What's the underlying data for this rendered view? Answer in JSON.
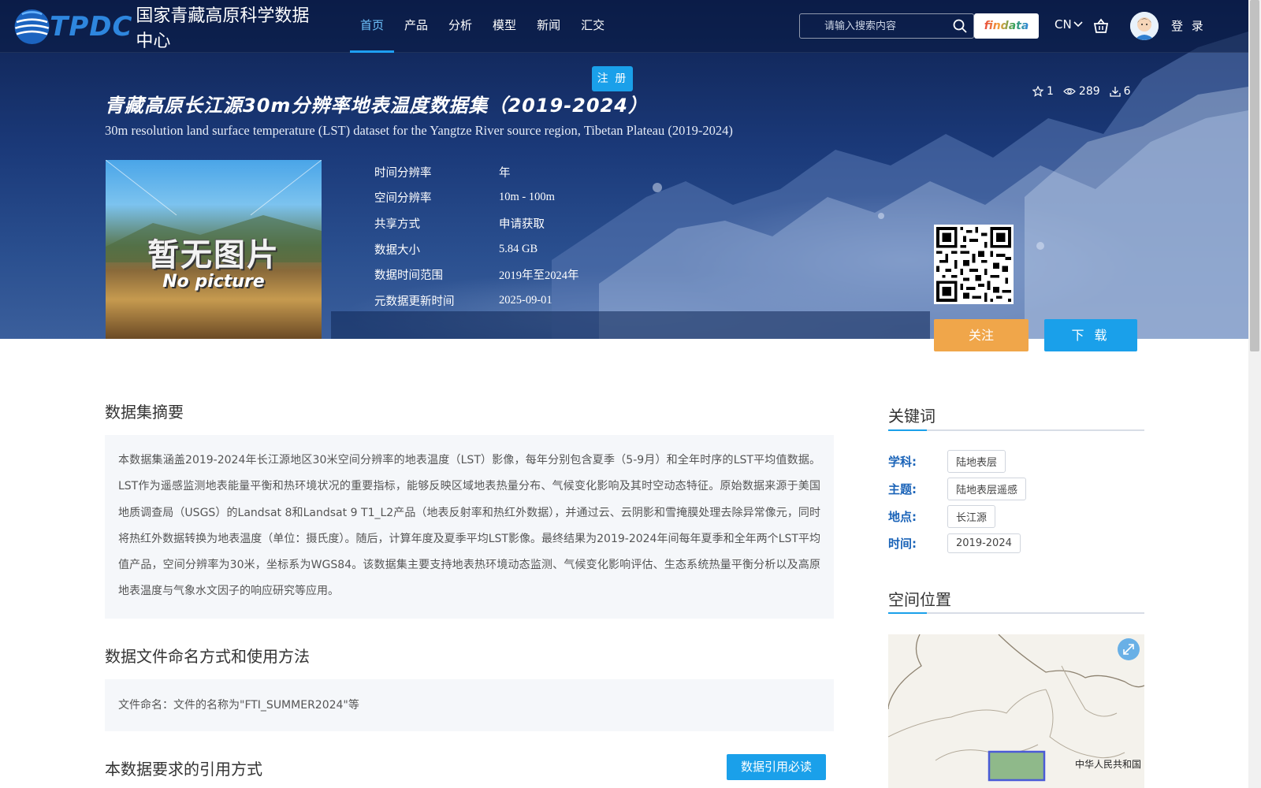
{
  "header": {
    "logo_abbr": "TPDC",
    "logo_name": "国家青藏高原科学数据中心",
    "nav": [
      "首页",
      "产品",
      "分析",
      "模型",
      "新闻",
      "汇交"
    ],
    "register_label": "注 册",
    "search_placeholder": "请输入搜索内容",
    "findata_label": "findata",
    "lang_label": "CN",
    "login_label": "登 录"
  },
  "dataset": {
    "title_cn": "青藏高原长江源30m分辨率地表温度数据集（2019-2024）",
    "title_en": "30m resolution land surface temperature (LST) dataset for the Yangtze River source region, Tibetan Plateau (2019-2024)",
    "stats": {
      "favorites": "1",
      "views": "289",
      "downloads": "6"
    },
    "thumb_cn": "暂无图片",
    "thumb_en": "No picture",
    "meta": [
      {
        "label": "时间分辨率",
        "value": "年"
      },
      {
        "label": "空间分辨率",
        "value": "10m - 100m"
      },
      {
        "label": "共享方式",
        "value": "申请获取"
      },
      {
        "label": "数据大小",
        "value": "5.84 GB"
      },
      {
        "label": "数据时间范围",
        "value": "2019年至2024年"
      },
      {
        "label": "元数据更新时间",
        "value": "2025-09-01"
      }
    ],
    "follow_label": "关注",
    "download_label": "下 载"
  },
  "content": {
    "abstract_title": "数据集摘要",
    "abstract_text": "本数据集涵盖2019-2024年长江源地区30米空间分辨率的地表温度（LST）影像，每年分别包含夏季（5-9月）和全年时序的LST平均值数据。LST作为遥感监测地表能量平衡和热环境状况的重要指标，能够反映区域地表热量分布、气候变化影响及其时空动态特征。原始数据来源于美国地质调查局（USGS）的Landsat 8和Landsat 9 T1_L2产品（地表反射率和热红外数据），并通过云、云阴影和雪掩膜处理去除异常像元，同时将热红外数据转换为地表温度（单位：摄氏度）。随后，计算年度及夏季平均LST影像。最终结果为2019-2024年间每年夏季和全年两个LST平均值产品，空间分辨率为30米，坐标系为WGS84。该数据集主要支持地表热环境动态监测、气候变化影响评估、生态系统热量平衡分析以及高原地表温度与气象水文因子的响应研究等应用。",
    "naming_title": "数据文件命名方式和使用方法",
    "naming_text": "文件命名：文件的名称为\"FTI_SUMMER2024\"等",
    "citation_title": "本数据要求的引用方式",
    "citation_button": "数据引用必读"
  },
  "sidebar": {
    "keywords_title": "关键词",
    "keywords": [
      {
        "label": "学科:",
        "tag": "陆地表层"
      },
      {
        "label": "主题:",
        "tag": "陆地表层遥感"
      },
      {
        "label": "地点:",
        "tag": "长江源"
      },
      {
        "label": "时间:",
        "tag": "2019-2024"
      }
    ],
    "location_title": "空间位置",
    "map_label": "中华人民共和国"
  }
}
